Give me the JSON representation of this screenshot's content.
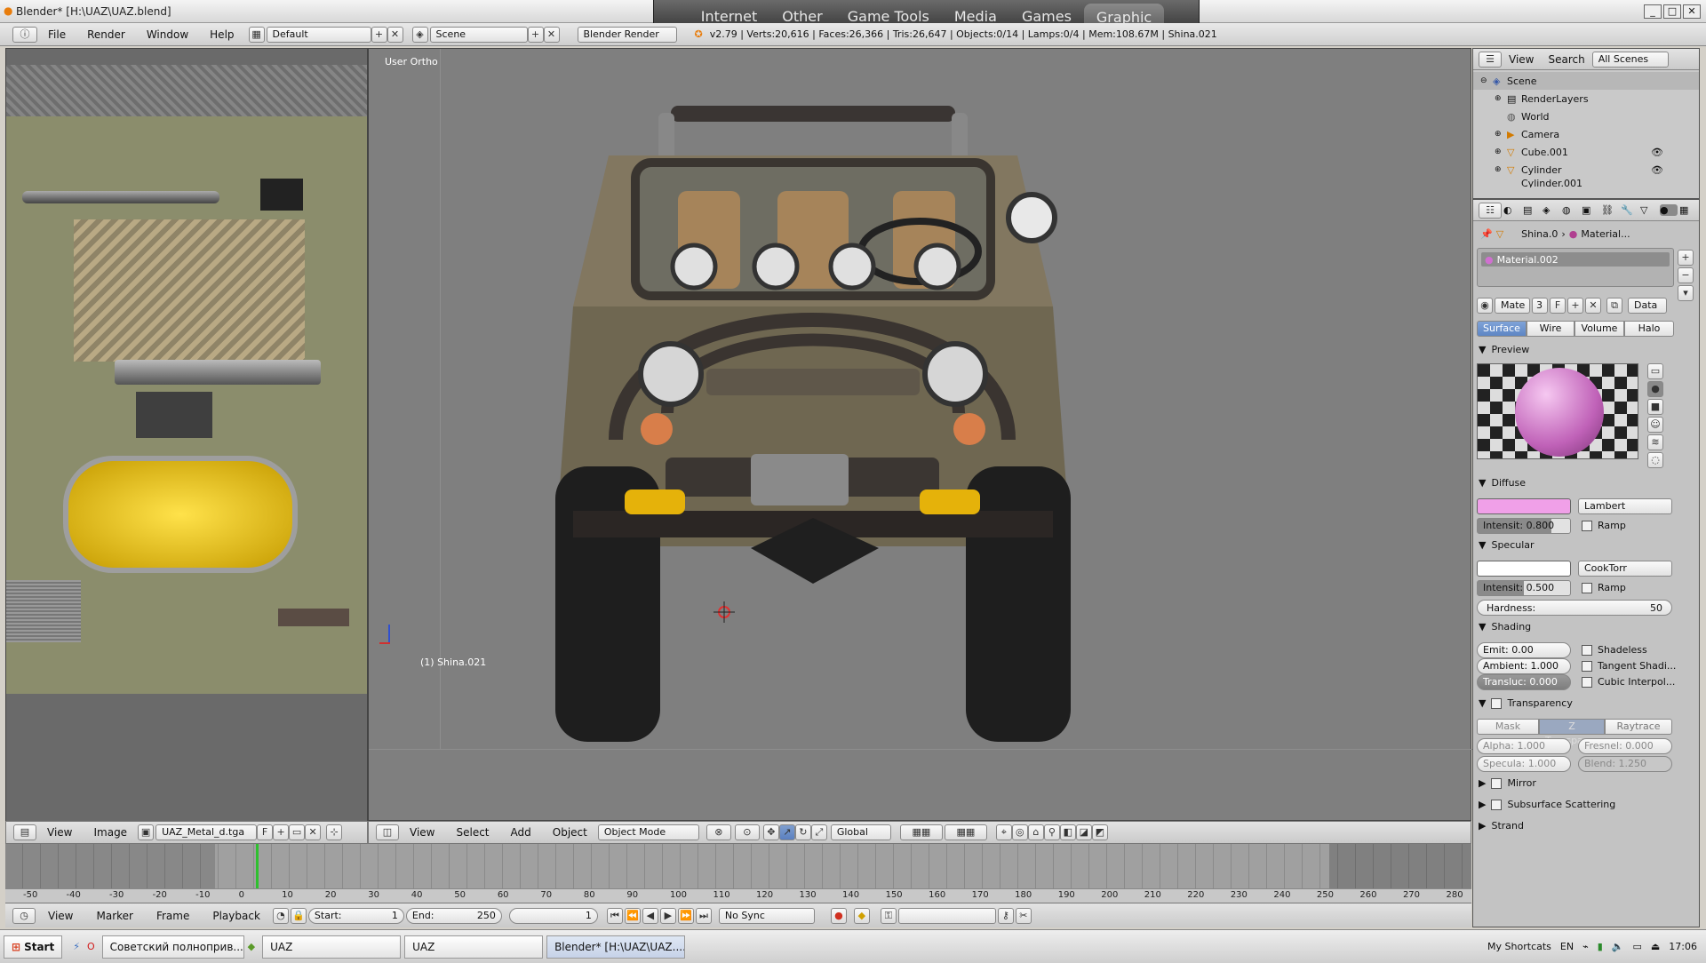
{
  "window": {
    "title": "Blender* [H:\\UAZ\\UAZ.blend]"
  },
  "top_menu": {
    "tabs": [
      "Internet",
      "Other",
      "Game Tools",
      "Media",
      "Games",
      "Graphic"
    ],
    "active": "Graphic"
  },
  "header": {
    "menus": [
      "File",
      "Render",
      "Window",
      "Help"
    ],
    "screen_layout": "Default",
    "scene": "Scene",
    "engine": "Blender Render",
    "stats": "v2.79 | Verts:20,616 | Faces:26,366 | Tris:26,647 | Objects:0/14 | Lamps:0/4 | Mem:108.67M | Shina.021"
  },
  "image_editor": {
    "menus": [
      "View",
      "Image"
    ],
    "image_name": "UAZ_Metal_d.tga",
    "fake_user": "F"
  },
  "viewport": {
    "view_label": "User Ortho",
    "object_label": "(1) Shina.021",
    "menus": [
      "View",
      "Select",
      "Add",
      "Object"
    ],
    "mode": "Object Mode",
    "orientation": "Global"
  },
  "outliner": {
    "menus": [
      "View",
      "Search"
    ],
    "display": "All Scenes",
    "items": [
      {
        "label": "Scene",
        "level": 0
      },
      {
        "label": "RenderLayers",
        "level": 1
      },
      {
        "label": "World",
        "level": 1
      },
      {
        "label": "Camera",
        "level": 1
      },
      {
        "label": "Cube.001",
        "level": 1
      },
      {
        "label": "Cylinder",
        "level": 1
      },
      {
        "label": "Cylinder.001",
        "level": 1
      }
    ]
  },
  "properties": {
    "breadcrumb": [
      "Shina.0",
      "Material..."
    ],
    "material_slot": "Material.002",
    "mat_name": "Mate",
    "users": "3",
    "fake": "F",
    "link": "Data",
    "tabs": [
      "Surface",
      "Wire",
      "Volume",
      "Halo"
    ],
    "active_tab": "Surface",
    "preview_title": "Preview",
    "diffuse": {
      "title": "Diffuse",
      "color": "#f0a0e8",
      "shader": "Lambert",
      "intensity": "Intensit:  0.800",
      "ramp": "Ramp"
    },
    "specular": {
      "title": "Specular",
      "color": "#ffffff",
      "shader": "CookTorr",
      "intensity": "Intensit:  0.500",
      "ramp": "Ramp",
      "hardness_label": "Hardness:",
      "hardness": "50"
    },
    "shading": {
      "title": "Shading",
      "emit": "Emit:        0.00",
      "ambient": "Ambient: 1.000",
      "transluc": "Transluc: 0.000",
      "shadeless": "Shadeless",
      "tangent": "Tangent Shadi...",
      "cubic": "Cubic Interpol..."
    },
    "transparency": {
      "title": "Transparency",
      "modes": [
        "Mask",
        "Z Transpare...",
        "Raytrace"
      ],
      "alpha": "Alpha:    1.000",
      "fresnel": "Fresnel:  0.000",
      "specula": "Specula:  1.000",
      "blend": "Blend:    1.250"
    },
    "mirror": "Mirror",
    "sss": "Subsurface Scattering",
    "strand": "Strand"
  },
  "timeline": {
    "ticks": [
      "-50",
      "-40",
      "-30",
      "-20",
      "-10",
      "0",
      "10",
      "20",
      "30",
      "40",
      "50",
      "60",
      "70",
      "80",
      "90",
      "100",
      "110",
      "120",
      "130",
      "140",
      "150",
      "160",
      "170",
      "180",
      "190",
      "200",
      "210",
      "220",
      "230",
      "240",
      "250",
      "260",
      "270",
      "280"
    ],
    "current_frame": 0,
    "menus": [
      "View",
      "Marker",
      "Frame",
      "Playback"
    ],
    "start": "Start:",
    "start_val": "1",
    "end": "End:",
    "end_val": "250",
    "frame": "1",
    "sync": "No Sync"
  },
  "taskbar": {
    "start": "Start",
    "tasks": [
      "Советский полноприв...",
      "UAZ",
      "UAZ",
      "Blender* [H:\\UAZ\\UAZ...."
    ],
    "shortcuts": "My Shortcats",
    "lang": "EN",
    "clock": "17:06"
  }
}
